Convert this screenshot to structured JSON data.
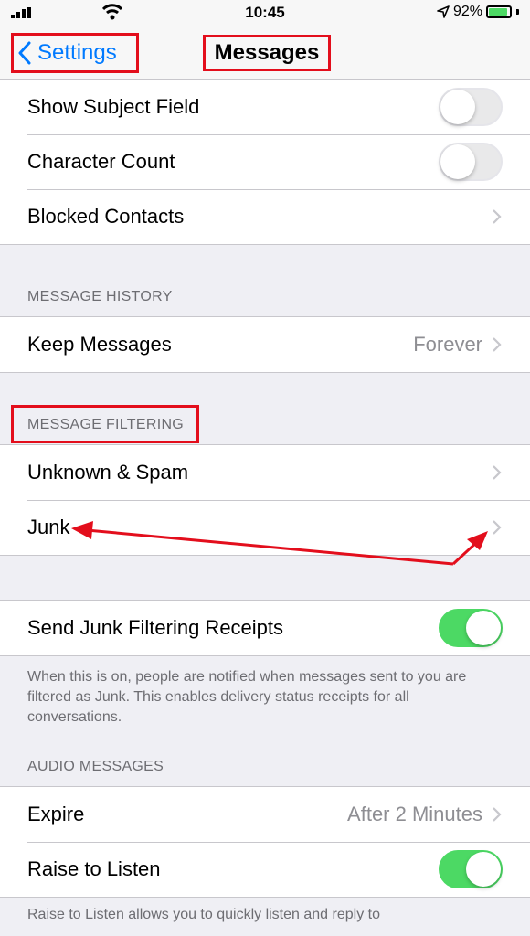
{
  "status_bar": {
    "time": "10:45",
    "battery_percent": "92%",
    "battery_level": 0.92
  },
  "nav": {
    "back_label": "Settings",
    "title": "Messages"
  },
  "rows_top": [
    {
      "label": "Show Subject Field",
      "toggle": false
    },
    {
      "label": "Character Count",
      "toggle": false
    },
    {
      "label": "Blocked Contacts"
    }
  ],
  "history": {
    "header": "MESSAGE HISTORY",
    "keep": {
      "label": "Keep Messages",
      "value": "Forever"
    }
  },
  "filtering": {
    "header": "MESSAGE FILTERING",
    "unknown": {
      "label": "Unknown & Spam"
    },
    "junk": {
      "label": "Junk"
    }
  },
  "receipts": {
    "label": "Send Junk Filtering Receipts",
    "toggle": true,
    "footer": "When this is on, people are notified when messages sent to you are filtered as Junk. This enables delivery status receipts for all conversations."
  },
  "audio": {
    "header": "AUDIO MESSAGES",
    "expire": {
      "label": "Expire",
      "value": "After 2 Minutes"
    },
    "raise": {
      "label": "Raise to Listen",
      "toggle": true
    },
    "footer": "Raise to Listen allows you to quickly listen and reply to"
  },
  "colors": {
    "accent": "#007aff",
    "toggle_on": "#4cd964",
    "annotation": "#e30e1c"
  }
}
